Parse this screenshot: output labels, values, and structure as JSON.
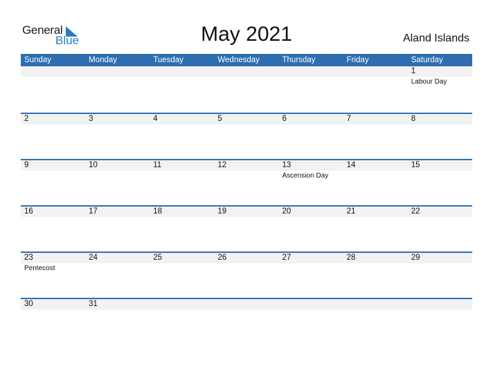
{
  "logo": {
    "general": "General",
    "blue": "Blue"
  },
  "title": "May 2021",
  "country": "Aland Islands",
  "colors": {
    "accent": "#2e6eb0",
    "shade": "#f2f2f2"
  },
  "weekdays": [
    "Sunday",
    "Monday",
    "Tuesday",
    "Wednesday",
    "Thursday",
    "Friday",
    "Saturday"
  ],
  "weeks": [
    [
      {
        "d": ""
      },
      {
        "d": ""
      },
      {
        "d": ""
      },
      {
        "d": ""
      },
      {
        "d": ""
      },
      {
        "d": ""
      },
      {
        "d": "1",
        "h": "Labour Day"
      }
    ],
    [
      {
        "d": "2"
      },
      {
        "d": "3"
      },
      {
        "d": "4"
      },
      {
        "d": "5"
      },
      {
        "d": "6"
      },
      {
        "d": "7"
      },
      {
        "d": "8"
      }
    ],
    [
      {
        "d": "9"
      },
      {
        "d": "10"
      },
      {
        "d": "11"
      },
      {
        "d": "12"
      },
      {
        "d": "13",
        "h": "Ascension Day"
      },
      {
        "d": "14"
      },
      {
        "d": "15"
      }
    ],
    [
      {
        "d": "16"
      },
      {
        "d": "17"
      },
      {
        "d": "18"
      },
      {
        "d": "19"
      },
      {
        "d": "20"
      },
      {
        "d": "21"
      },
      {
        "d": "22"
      }
    ],
    [
      {
        "d": "23",
        "h": "Pentecost"
      },
      {
        "d": "24"
      },
      {
        "d": "25"
      },
      {
        "d": "26"
      },
      {
        "d": "27"
      },
      {
        "d": "28"
      },
      {
        "d": "29"
      }
    ],
    [
      {
        "d": "30"
      },
      {
        "d": "31"
      },
      {
        "d": ""
      },
      {
        "d": ""
      },
      {
        "d": ""
      },
      {
        "d": ""
      },
      {
        "d": ""
      }
    ]
  ]
}
